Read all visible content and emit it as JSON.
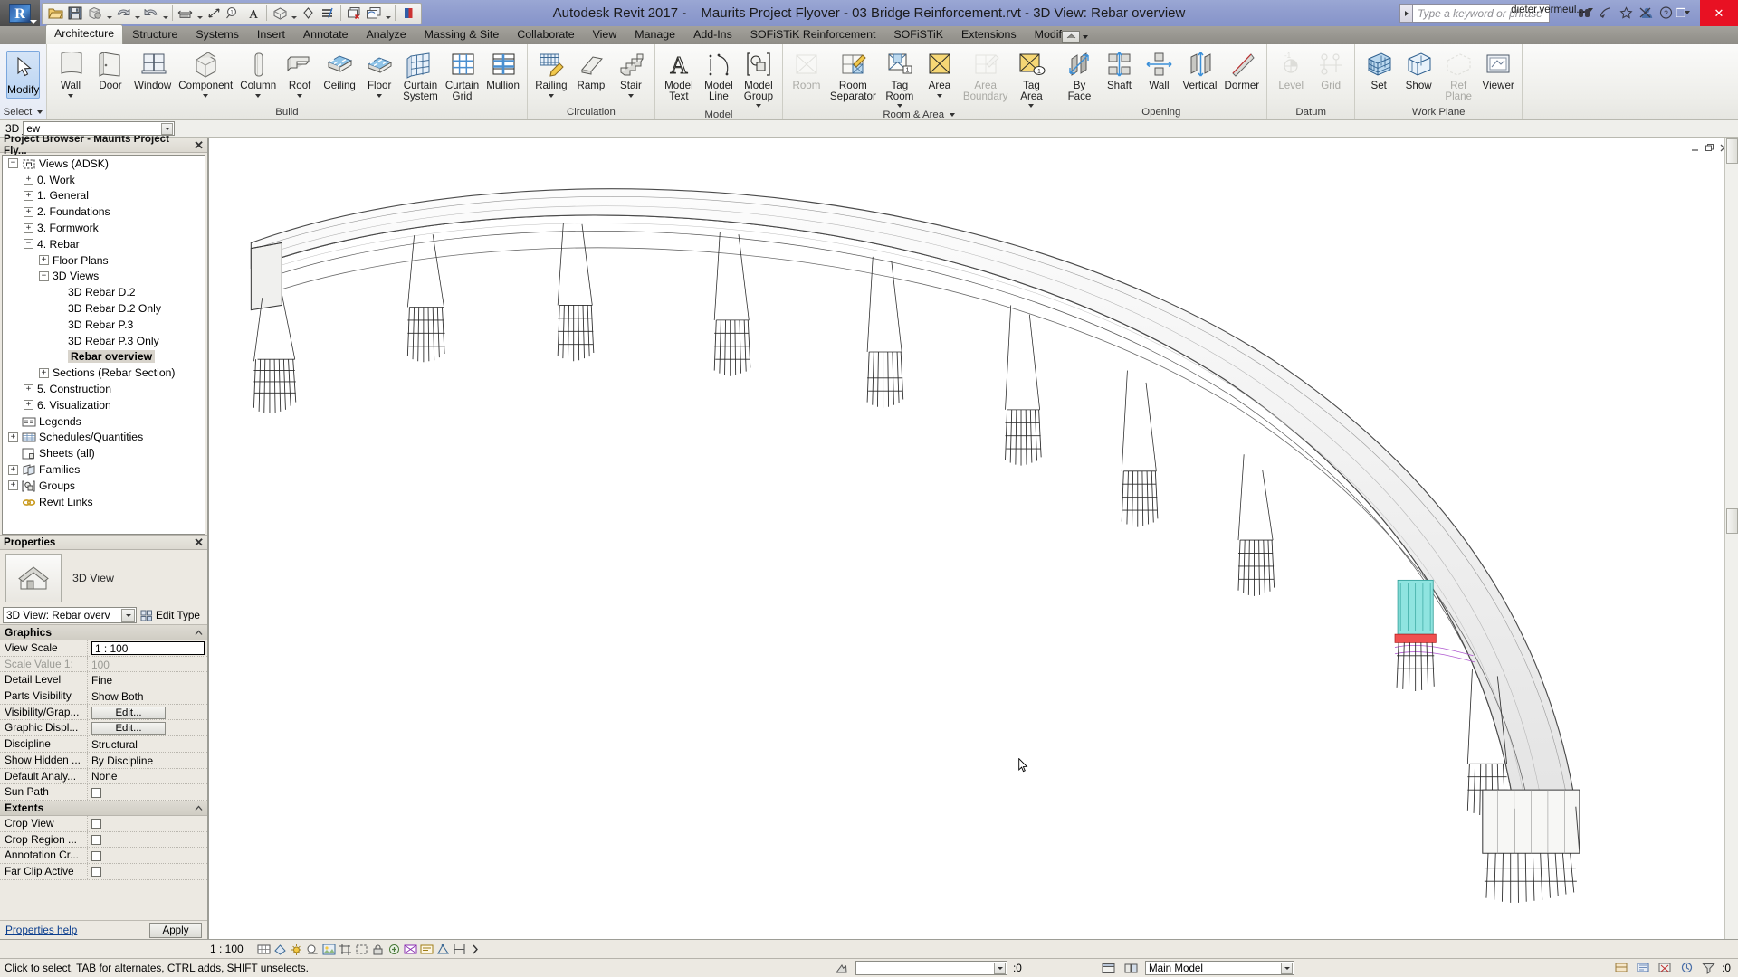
{
  "titlebar": {
    "app_title": "Autodesk Revit 2017 -",
    "document_title": "Maurits Project Flyover - 03 Bridge Reinforcement.rvt - 3D View: Rebar overview",
    "search_placeholder": "Type a keyword or phrase",
    "user": "dieter.vermeul...",
    "minimize": "–",
    "maximize": "❐",
    "close": "✕",
    "qat_icons": [
      "open-icon",
      "save-icon",
      "export-icon",
      "undo-icon",
      "redo-icon",
      "measure-icon",
      "aligned-dimension-icon",
      "tag-icon",
      "text-icon",
      "default-3d-view-icon",
      "section-icon",
      "thin-lines-icon",
      "close-hidden-windows-icon",
      "switch-windows-icon",
      "more-icon"
    ]
  },
  "tabs": [
    {
      "label": "Architecture",
      "active": true
    },
    {
      "label": "Structure",
      "active": false
    },
    {
      "label": "Systems",
      "active": false
    },
    {
      "label": "Insert",
      "active": false
    },
    {
      "label": "Annotate",
      "active": false
    },
    {
      "label": "Analyze",
      "active": false
    },
    {
      "label": "Massing & Site",
      "active": false
    },
    {
      "label": "Collaborate",
      "active": false
    },
    {
      "label": "View",
      "active": false
    },
    {
      "label": "Manage",
      "active": false
    },
    {
      "label": "Add-Ins",
      "active": false
    },
    {
      "label": "SOFiSTiK Reinforcement",
      "active": false
    },
    {
      "label": "SOFiSTiK",
      "active": false
    },
    {
      "label": "Extensions",
      "active": false
    },
    {
      "label": "Modify",
      "active": false
    }
  ],
  "ribbon": {
    "select_panel_label": "Select",
    "modify_button": "Modify",
    "panels": [
      {
        "label": "Build",
        "buttons": [
          {
            "label": "Wall",
            "icon": "wall-icon",
            "dropdown": true,
            "disabled": false
          },
          {
            "label": "Door",
            "icon": "door-icon",
            "dropdown": false,
            "disabled": false
          },
          {
            "label": "Window",
            "icon": "window-icon",
            "dropdown": false,
            "disabled": false
          },
          {
            "label": "Component",
            "icon": "component-icon",
            "dropdown": true,
            "disabled": false
          },
          {
            "label": "Column",
            "icon": "column-icon",
            "dropdown": true,
            "disabled": false
          },
          {
            "label": "Roof",
            "icon": "roof-icon",
            "dropdown": true,
            "disabled": false
          },
          {
            "label": "Ceiling",
            "icon": "ceiling-icon",
            "dropdown": false,
            "disabled": false
          },
          {
            "label": "Floor",
            "icon": "floor-icon",
            "dropdown": true,
            "disabled": false
          },
          {
            "label": "Curtain System",
            "icon": "curtain-system-icon",
            "dropdown": false,
            "disabled": false
          },
          {
            "label": "Curtain Grid",
            "icon": "curtain-grid-icon",
            "dropdown": false,
            "disabled": false
          },
          {
            "label": "Mullion",
            "icon": "mullion-icon",
            "dropdown": false,
            "disabled": false
          }
        ]
      },
      {
        "label": "Circulation",
        "buttons": [
          {
            "label": "Railing",
            "icon": "railing-icon",
            "dropdown": true,
            "disabled": false
          },
          {
            "label": "Ramp",
            "icon": "ramp-icon",
            "dropdown": false,
            "disabled": false
          },
          {
            "label": "Stair",
            "icon": "stair-icon",
            "dropdown": true,
            "disabled": false
          }
        ]
      },
      {
        "label": "Model",
        "buttons": [
          {
            "label": "Model Text",
            "icon": "model-text-icon",
            "dropdown": false,
            "disabled": false
          },
          {
            "label": "Model Line",
            "icon": "model-line-icon",
            "dropdown": false,
            "disabled": false
          },
          {
            "label": "Model Group",
            "icon": "model-group-icon",
            "dropdown": true,
            "disabled": false
          }
        ]
      },
      {
        "label": "Room & Area",
        "dropdown": true,
        "buttons": [
          {
            "label": "Room",
            "icon": "room-icon",
            "dropdown": false,
            "disabled": true
          },
          {
            "label": "Room Separator",
            "icon": "room-separator-icon",
            "dropdown": false,
            "disabled": false
          },
          {
            "label": "Tag Room",
            "icon": "tag-room-icon",
            "dropdown": true,
            "disabled": false
          },
          {
            "label": "Area",
            "icon": "area-icon",
            "dropdown": true,
            "disabled": false
          },
          {
            "label": "Area Boundary",
            "icon": "area-boundary-icon",
            "dropdown": false,
            "disabled": true
          },
          {
            "label": "Tag Area",
            "icon": "tag-area-icon",
            "dropdown": true,
            "disabled": false
          }
        ]
      },
      {
        "label": "Opening",
        "buttons": [
          {
            "label": "By Face",
            "icon": "opening-by-face-icon",
            "dropdown": false,
            "disabled": false
          },
          {
            "label": "Shaft",
            "icon": "shaft-opening-icon",
            "dropdown": false,
            "disabled": false
          },
          {
            "label": "Wall",
            "icon": "wall-opening-icon",
            "dropdown": false,
            "disabled": false
          },
          {
            "label": "Vertical",
            "icon": "vertical-opening-icon",
            "dropdown": false,
            "disabled": false
          },
          {
            "label": "Dormer",
            "icon": "dormer-opening-icon",
            "dropdown": false,
            "disabled": false
          }
        ]
      },
      {
        "label": "Datum",
        "buttons": [
          {
            "label": "Level",
            "icon": "level-icon",
            "dropdown": false,
            "disabled": true
          },
          {
            "label": "Grid",
            "icon": "grid-icon",
            "dropdown": false,
            "disabled": true
          }
        ]
      },
      {
        "label": "Work Plane",
        "buttons": [
          {
            "label": "Set",
            "icon": "set-work-plane-icon",
            "dropdown": false,
            "disabled": false
          },
          {
            "label": "Show",
            "icon": "show-work-plane-icon",
            "dropdown": false,
            "disabled": false
          },
          {
            "label": "Ref Plane",
            "icon": "reference-plane-icon",
            "dropdown": false,
            "disabled": true
          },
          {
            "label": "Viewer",
            "icon": "work-plane-viewer-icon",
            "dropdown": false,
            "disabled": false
          }
        ]
      }
    ]
  },
  "options_bar": {
    "label": "3D",
    "value": "ew"
  },
  "project_browser": {
    "title": "Project Browser - Maurits Project Fly...",
    "close_label": "✕",
    "nodes": [
      {
        "label": "Views (ADSK)",
        "depth": 0,
        "expander": "minus",
        "icon": "views-icon",
        "selected": false
      },
      {
        "label": "0. Work",
        "depth": 1,
        "expander": "plus",
        "icon": "none",
        "selected": false
      },
      {
        "label": "1. General",
        "depth": 1,
        "expander": "plus",
        "icon": "none",
        "selected": false
      },
      {
        "label": "2. Foundations",
        "depth": 1,
        "expander": "plus",
        "icon": "none",
        "selected": false
      },
      {
        "label": "3. Formwork",
        "depth": 1,
        "expander": "plus",
        "icon": "none",
        "selected": false
      },
      {
        "label": "4. Rebar",
        "depth": 1,
        "expander": "minus",
        "icon": "none",
        "selected": false
      },
      {
        "label": "Floor Plans",
        "depth": 2,
        "expander": "plus",
        "icon": "none",
        "selected": false
      },
      {
        "label": "3D Views",
        "depth": 2,
        "expander": "minus",
        "icon": "none",
        "selected": false
      },
      {
        "label": "3D Rebar D.2",
        "depth": 3,
        "expander": "none",
        "icon": "none",
        "selected": false
      },
      {
        "label": "3D Rebar D.2 Only",
        "depth": 3,
        "expander": "none",
        "icon": "none",
        "selected": false
      },
      {
        "label": "3D Rebar P.3",
        "depth": 3,
        "expander": "none",
        "icon": "none",
        "selected": false
      },
      {
        "label": "3D Rebar P.3 Only",
        "depth": 3,
        "expander": "none",
        "icon": "none",
        "selected": false
      },
      {
        "label": "Rebar overview",
        "depth": 3,
        "expander": "none",
        "icon": "none",
        "selected": true
      },
      {
        "label": "Sections (Rebar Section)",
        "depth": 2,
        "expander": "plus",
        "icon": "none",
        "selected": false
      },
      {
        "label": "5. Construction",
        "depth": 1,
        "expander": "plus",
        "icon": "none",
        "selected": false
      },
      {
        "label": "6. Visualization",
        "depth": 1,
        "expander": "plus",
        "icon": "none",
        "selected": false
      },
      {
        "label": "Legends",
        "depth": 0,
        "expander": "none",
        "icon": "legend-icon",
        "selected": false
      },
      {
        "label": "Schedules/Quantities",
        "depth": 0,
        "expander": "plus",
        "icon": "schedule-icon",
        "selected": false
      },
      {
        "label": "Sheets (all)",
        "depth": 0,
        "expander": "none",
        "icon": "sheet-icon",
        "selected": false
      },
      {
        "label": "Families",
        "depth": 0,
        "expander": "plus",
        "icon": "family-icon",
        "selected": false
      },
      {
        "label": "Groups",
        "depth": 0,
        "expander": "plus",
        "icon": "group-icon",
        "selected": false
      },
      {
        "label": "Revit Links",
        "depth": 0,
        "expander": "none",
        "icon": "link-icon",
        "selected": false
      }
    ]
  },
  "properties": {
    "title": "Properties",
    "close_label": "✕",
    "category": "3D View",
    "type_selector": "3D View: Rebar overv",
    "edit_type_label": "Edit Type",
    "help_link": "Properties help",
    "apply_label": "Apply",
    "groups": [
      {
        "name": "Graphics",
        "rows": [
          {
            "key": "View Scale",
            "value": "1 : 100",
            "kind": "input",
            "disabled": false
          },
          {
            "key": "Scale Value    1:",
            "value": "100",
            "kind": "text",
            "disabled": true
          },
          {
            "key": "Detail Level",
            "value": "Fine",
            "kind": "text",
            "disabled": false
          },
          {
            "key": "Parts Visibility",
            "value": "Show Both",
            "kind": "text",
            "disabled": false
          },
          {
            "key": "Visibility/Grap...",
            "value": "Edit...",
            "kind": "button",
            "disabled": false
          },
          {
            "key": "Graphic Displ...",
            "value": "Edit...",
            "kind": "button",
            "disabled": false
          },
          {
            "key": "Discipline",
            "value": "Structural",
            "kind": "text",
            "disabled": false
          },
          {
            "key": "Show Hidden ...",
            "value": "By Discipline",
            "kind": "text",
            "disabled": false
          },
          {
            "key": "Default Analy...",
            "value": "None",
            "kind": "text",
            "disabled": false
          },
          {
            "key": "Sun Path",
            "value": "",
            "kind": "checkbox",
            "disabled": false
          }
        ]
      },
      {
        "name": "Extents",
        "rows": [
          {
            "key": "Crop View",
            "value": "",
            "kind": "checkbox",
            "disabled": false
          },
          {
            "key": "Crop Region ...",
            "value": "",
            "kind": "checkbox",
            "disabled": false
          },
          {
            "key": "Annotation Cr...",
            "value": "",
            "kind": "checkbox",
            "disabled": false
          },
          {
            "key": "Far Clip Active",
            "value": "",
            "kind": "checkbox",
            "disabled": false
          }
        ]
      }
    ]
  },
  "view_control_bar": {
    "scale": "1 : 100",
    "icons": [
      "detail-level-icon",
      "visual-style-icon",
      "sun-path-icon",
      "shadows-icon",
      "render-dialog-icon",
      "crop-view-icon",
      "show-crop-region-icon",
      "lock-3d-view-icon",
      "temporary-hide-isolate-icon",
      "reveal-hidden-elements-icon",
      "temporary-view-properties-icon",
      "analytical-model-icon",
      "constraints-icon",
      "more-icon"
    ]
  },
  "status_bar": {
    "message": "Click to select, TAB for alternates, CTRL adds, SHIFT unselects.",
    "selection_count": ":0",
    "workset": "Main Model",
    "filter_count": ":0",
    "right_icons": [
      "design-options-icon",
      "editable-only-icon",
      "exclude-options-icon",
      "filter-icon",
      "worksets-icon",
      "model-updates-icon"
    ]
  },
  "canvas": {
    "view_name": "Rebar overview",
    "window_controls": [
      "minimize-view-icon",
      "restore-view-icon",
      "close-view-icon"
    ]
  }
}
